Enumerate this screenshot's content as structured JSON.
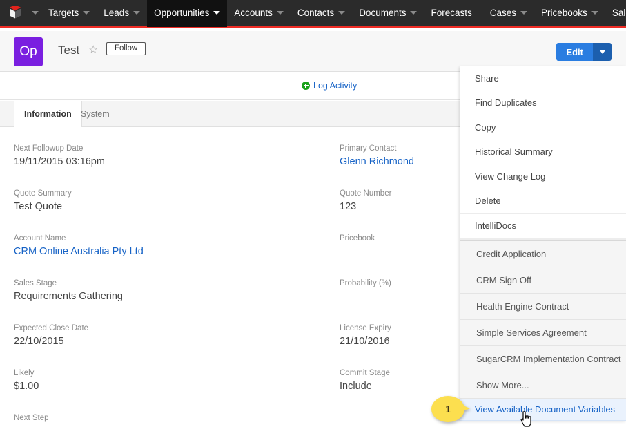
{
  "navbar": {
    "logo_icon": "cube-logo-icon",
    "items": [
      {
        "label": "Targets",
        "has_caret": true,
        "active": false
      },
      {
        "label": "Leads",
        "has_caret": true,
        "active": false
      },
      {
        "label": "Opportunities",
        "has_caret": true,
        "active": true
      },
      {
        "label": "Accounts",
        "has_caret": true,
        "active": false
      },
      {
        "label": "Contacts",
        "has_caret": true,
        "active": false
      },
      {
        "label": "Documents",
        "has_caret": true,
        "active": false
      },
      {
        "label": "Forecasts",
        "has_caret": false,
        "active": false
      },
      {
        "label": "Cases",
        "has_caret": true,
        "active": false
      },
      {
        "label": "Pricebooks",
        "has_caret": true,
        "active": false
      },
      {
        "label": "Sale I",
        "has_caret": false,
        "active": false
      }
    ],
    "accent_color": "#ee2b24",
    "background_color": "#2b2b2b"
  },
  "record_header": {
    "avatar_text": "Op",
    "avatar_color": "#7a1fe0",
    "title": "Test",
    "star_icon": "star-outline-icon",
    "follow_label": "Follow",
    "edit_label": "Edit",
    "edit_color": "#2a7de1"
  },
  "action_strip": {
    "log_activity_label": "Log Activity",
    "plus_icon": "plus-circle-icon",
    "plus_color": "#1aa11a"
  },
  "tabs": [
    {
      "label": "Information",
      "active": true
    },
    {
      "label": "System",
      "active": false
    }
  ],
  "fields": {
    "left": [
      {
        "label": "Next Followup Date",
        "value": "19/11/2015 03:16pm",
        "is_link": false
      },
      {
        "label": "Quote Summary",
        "value": "Test Quote",
        "is_link": false
      },
      {
        "label": "Account Name",
        "value": "CRM Online Australia Pty Ltd",
        "is_link": true
      },
      {
        "label": "Sales Stage",
        "value": "Requirements Gathering",
        "is_link": false
      },
      {
        "label": "Expected Close Date",
        "value": "22/10/2015",
        "is_link": false
      },
      {
        "label": "Likely",
        "value": "$1.00",
        "is_link": false
      },
      {
        "label": "Next Step",
        "value": "",
        "is_link": false
      }
    ],
    "right": [
      {
        "label": "Primary Contact",
        "value": "Glenn Richmond",
        "is_link": true
      },
      {
        "label": "Quote Number",
        "value": "123",
        "is_link": false
      },
      {
        "label": "Pricebook",
        "value": "",
        "is_link": false
      },
      {
        "label": "Probability (%)",
        "value": "",
        "is_link": false
      },
      {
        "label": "License Expiry",
        "value": "21/10/2016",
        "is_link": false
      },
      {
        "label": "Commit Stage",
        "value": "Include",
        "is_link": false
      }
    ]
  },
  "dropdown_menu": {
    "primary_items": [
      {
        "label": "Share"
      },
      {
        "label": "Find Duplicates"
      },
      {
        "label": "Copy"
      },
      {
        "label": "Historical Summary"
      },
      {
        "label": "View Change Log"
      },
      {
        "label": "Delete"
      },
      {
        "label": "IntelliDocs"
      }
    ],
    "template_items": [
      {
        "label": "Credit Application"
      },
      {
        "label": "CRM Sign Off"
      },
      {
        "label": "Health Engine Contract"
      },
      {
        "label": "Simple Services Agreement"
      },
      {
        "label": "SugarCRM Implementation Contract"
      },
      {
        "label": "Show More..."
      }
    ],
    "highlighted_item": {
      "label": "View Available Document Variables",
      "color": "#1763c6"
    }
  },
  "callout": {
    "number": "1",
    "color": "#fcdf4f"
  },
  "cursor": {
    "icon": "pointing-hand-cursor"
  }
}
